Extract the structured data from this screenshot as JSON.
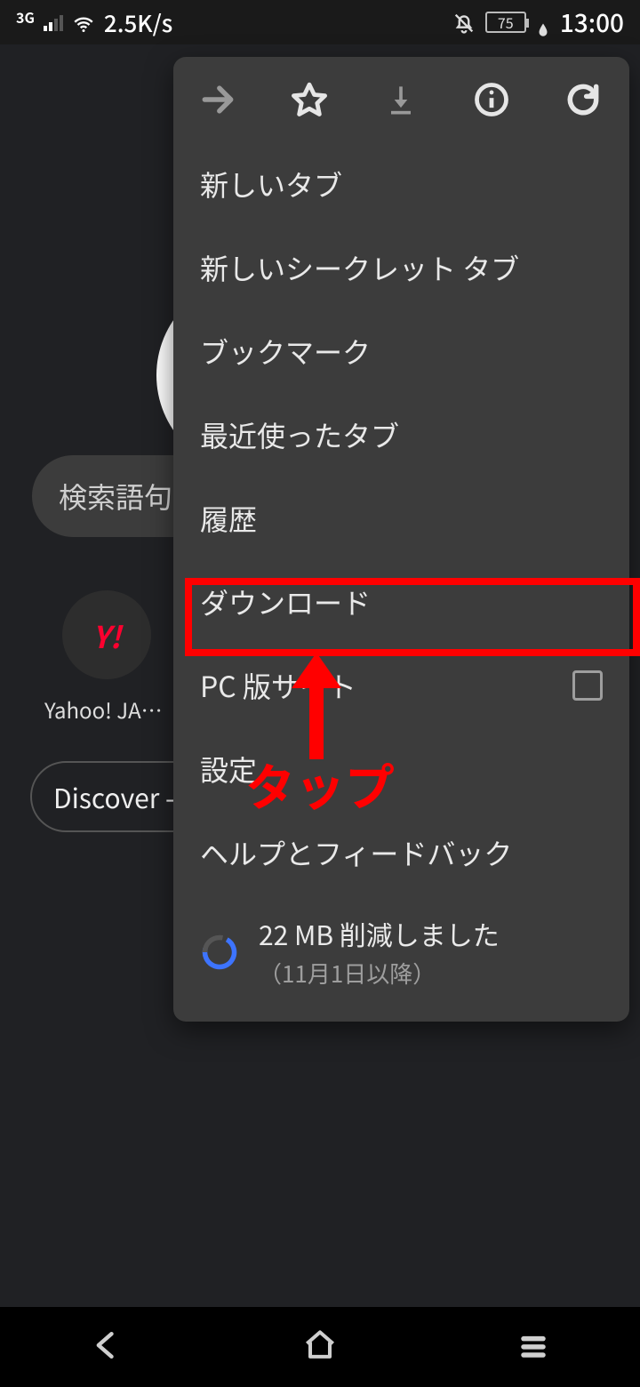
{
  "status": {
    "network_label": "3G",
    "speed": "2.5K/s",
    "battery_pct": "75",
    "time": "13:00"
  },
  "background": {
    "search_placeholder": "検索語句",
    "shortcut_icon_text": "Y!",
    "shortcut_label": "Yahoo! JAP...",
    "discover_label": "Discover -"
  },
  "menu": {
    "items": {
      "new_tab": "新しいタブ",
      "new_incognito": "新しいシークレット タブ",
      "bookmarks": "ブックマーク",
      "recent_tabs": "最近使ったタブ",
      "history": "履歴",
      "downloads": "ダウンロード",
      "desktop_site": "PC 版サイト",
      "settings": "設定",
      "help": "ヘルプとフィードバック"
    },
    "data_saver": {
      "main": "22 MB 削減しました",
      "sub": "（11月1日以降）"
    }
  },
  "annotation": {
    "label": "タップ"
  }
}
